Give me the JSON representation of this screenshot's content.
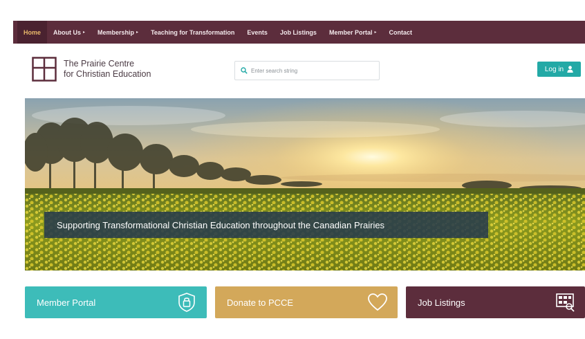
{
  "nav": {
    "items": [
      {
        "label": "Home",
        "active": true,
        "has_menu": false
      },
      {
        "label": "About Us",
        "active": false,
        "has_menu": true
      },
      {
        "label": "Membership",
        "active": false,
        "has_menu": true
      },
      {
        "label": "Teaching for Transformation",
        "active": false,
        "has_menu": false
      },
      {
        "label": "Events",
        "active": false,
        "has_menu": false
      },
      {
        "label": "Job Listings",
        "active": false,
        "has_menu": false
      },
      {
        "label": "Member Portal",
        "active": false,
        "has_menu": true
      },
      {
        "label": "Contact",
        "active": false,
        "has_menu": false
      }
    ],
    "caret": "▸"
  },
  "header": {
    "logo_line1": "The Prairie Centre",
    "logo_line2": "for Christian Education",
    "search_placeholder": "Enter search string",
    "login_label": "Log in"
  },
  "hero": {
    "tagline": "Supporting Transformational Christian Education throughout the Canadian Prairies"
  },
  "tiles": {
    "member_portal": "Member Portal",
    "donate": "Donate to PCCE",
    "job_listings": "Job Listings"
  },
  "colors": {
    "nav_bg": "#5c2d3c",
    "nav_active_text": "#e8b86a",
    "login_bg": "#23a9a6",
    "tile_member": "#3dbcb9",
    "tile_donate": "#d3a85a",
    "tile_jobs": "#5c2d3c",
    "tagline_bg": "#263a4c"
  },
  "icons": {
    "search": "search-icon",
    "login": "user-icon",
    "member_portal": "lock-badge-icon",
    "donate": "heart-icon",
    "job_listings": "job-board-icon"
  }
}
